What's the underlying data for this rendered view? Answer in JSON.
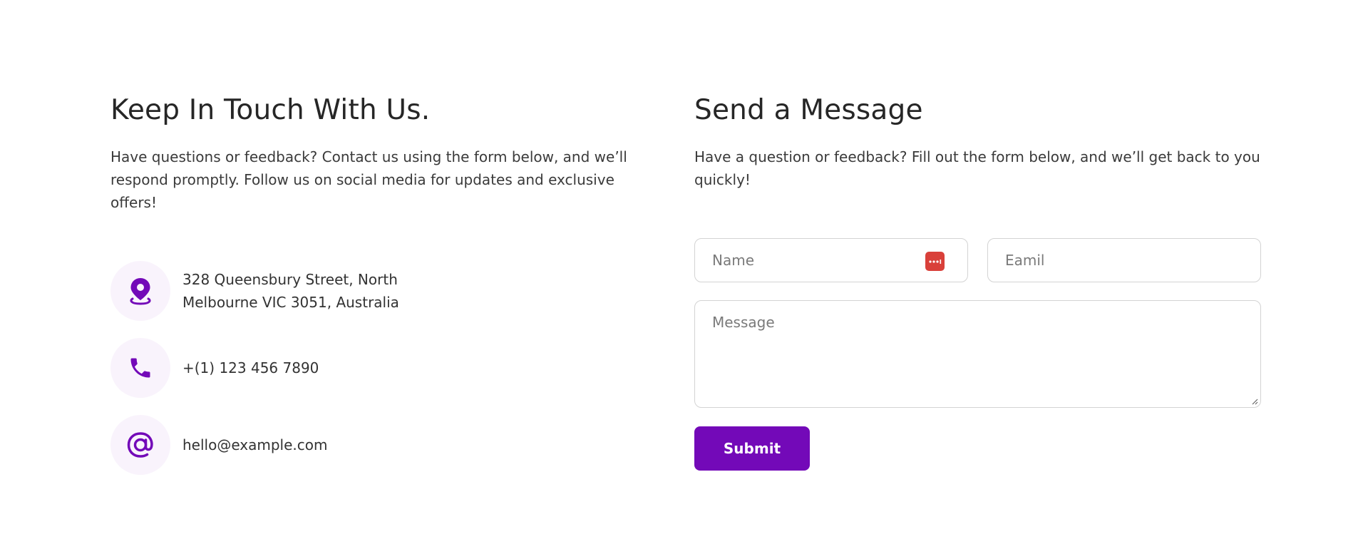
{
  "colors": {
    "accent": "#7309b8",
    "icon_bg": "#f9f3fc",
    "password_manager_icon": "#d9403a"
  },
  "left": {
    "title": "Keep In Touch With Us.",
    "intro": "Have questions or feedback? Contact us using the form below, and we’ll respond promptly. Follow us on social media for updates and exclusive offers!",
    "contacts": [
      {
        "icon": "location-pin-icon",
        "line1": "328 Queensbury Street, North",
        "line2": "Melbourne VIC 3051, Australia"
      },
      {
        "icon": "phone-icon",
        "line1": "+(1) 123 456 7890"
      },
      {
        "icon": "at-sign-icon",
        "line1": "hello@example.com"
      }
    ]
  },
  "right": {
    "title": "Send a Message",
    "intro": "Have a question or feedback? Fill out the form below, and we’ll get back to you quickly!",
    "form": {
      "name_placeholder": "Name",
      "name_value": "",
      "email_placeholder": "Eamil",
      "email_value": "",
      "message_placeholder": "Message",
      "message_value": "",
      "submit_label": "Submit"
    }
  }
}
